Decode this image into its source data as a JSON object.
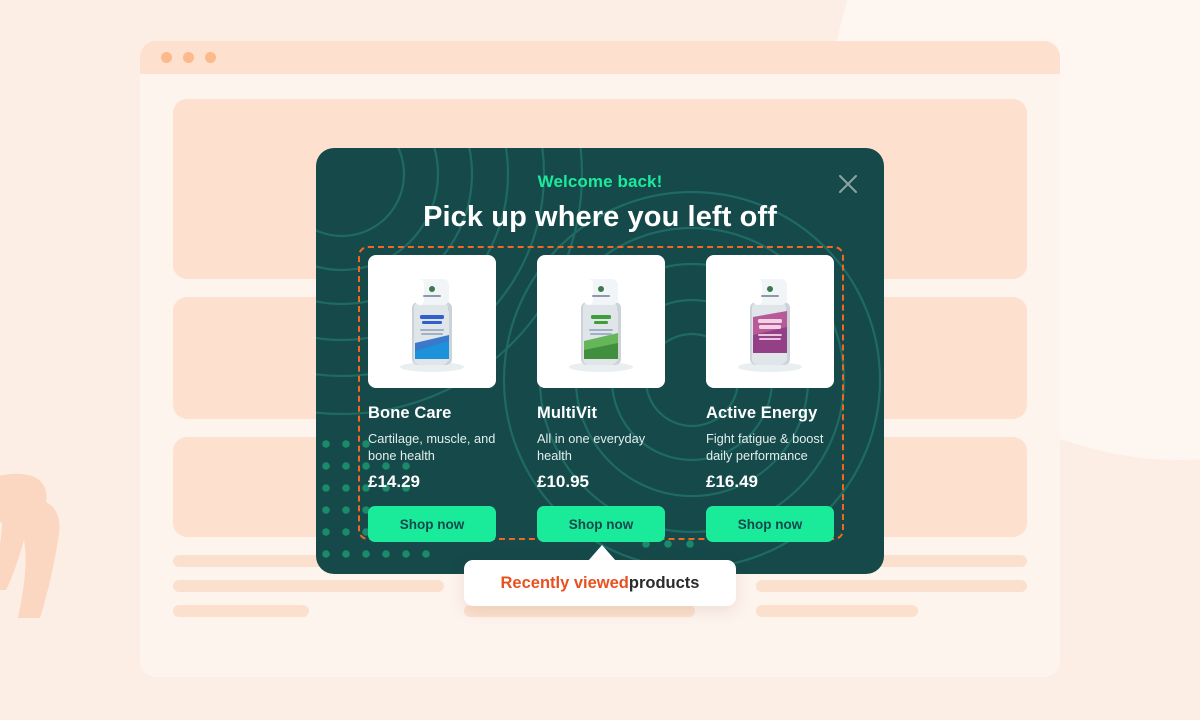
{
  "browser": {
    "traffic_lights": [
      "red-dot",
      "yellow-dot",
      "green-dot"
    ]
  },
  "modal": {
    "eyebrow": "Welcome back!",
    "headline": "Pick up where you left off",
    "close_icon": "close-icon",
    "accent_green": "#1aeb9b",
    "background": "#15494a",
    "dashed_border_color": "#f4671f"
  },
  "products": [
    {
      "name": "Bone Care",
      "description": "Cartilage, muscle, and bone health",
      "price": "£14.29",
      "cta": "Shop now",
      "label_color": "#2f5fd0",
      "accent_color": "#1e66c8"
    },
    {
      "name": "MultiVit",
      "description": "All in one everyday health",
      "price": "£10.95",
      "cta": "Shop now",
      "label_color": "#3f9e3a",
      "accent_color": "#4fae3f"
    },
    {
      "name": "Active Energy",
      "description": "Fight fatigue & boost daily performance",
      "price": "£16.49",
      "cta": "Shop now",
      "label_color": "#a8327f",
      "accent_color": "#b03a88"
    }
  ],
  "tooltip": {
    "accent_text": "Recently viewed",
    "rest_text": " products",
    "accent_color": "#e8501f"
  }
}
